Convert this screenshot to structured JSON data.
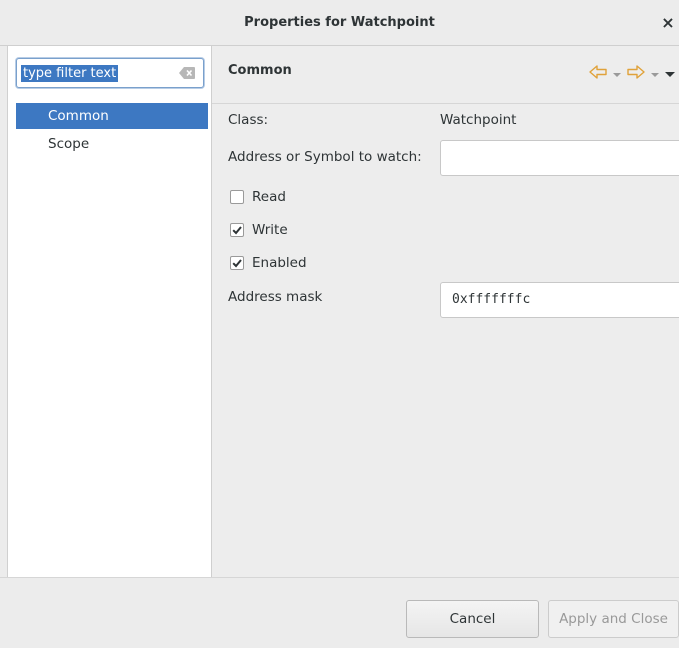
{
  "window": {
    "title": "Properties for Watchpoint",
    "close_glyph": "×"
  },
  "sidebar": {
    "filter_placeholder": "type filter text",
    "items": [
      {
        "label": "Common",
        "selected": true
      },
      {
        "label": "Scope",
        "selected": false
      }
    ]
  },
  "main": {
    "section_title": "Common",
    "fields": {
      "class_label": "Class:",
      "class_value": "Watchpoint",
      "address_label": "Address or Symbol to watch:",
      "address_value": "",
      "mask_label": "Address mask",
      "mask_value": "0xfffffffc"
    },
    "checkboxes": [
      {
        "label": "Read",
        "checked": false
      },
      {
        "label": "Write",
        "checked": true
      },
      {
        "label": "Enabled",
        "checked": true
      }
    ]
  },
  "buttons": {
    "cancel": "Cancel",
    "apply_close": "Apply and Close"
  },
  "colors": {
    "selection": "#3d78c2",
    "nav_arrow": "#e0a23a"
  }
}
